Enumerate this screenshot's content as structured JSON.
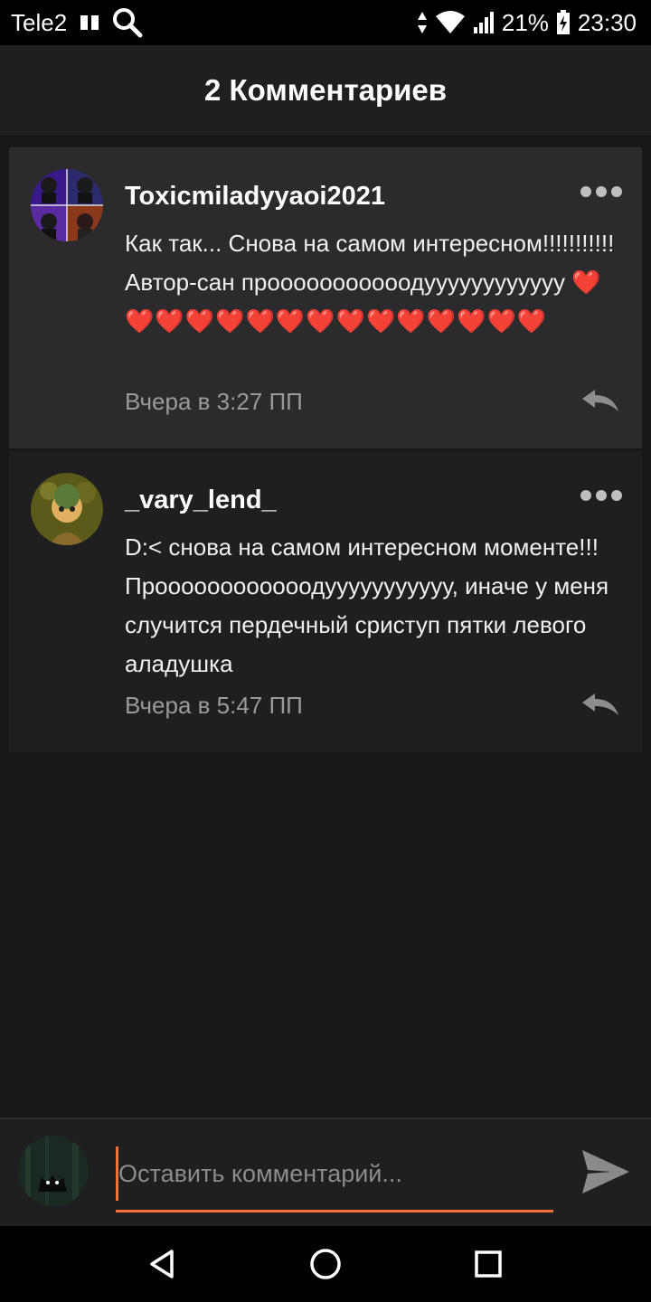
{
  "status_bar": {
    "carrier": "Tele2",
    "battery_percent": "21%",
    "time": "23:30"
  },
  "header": {
    "title": "2 Комментариев"
  },
  "comments": [
    {
      "username": "Toxicmiladyyaoi2021",
      "text": "Как так... Снова на самом интересном!!!!!!!!!!! Автор-сан прооооооооооодуууууууууууу",
      "hearts": "❤️❤️❤️❤️❤️❤️❤️❤️❤️❤️❤️❤️❤️❤️❤️",
      "timestamp": "Вчера в 3:27 ПП"
    },
    {
      "username": "_vary_lend_",
      "text": "D:< снова на самом интересном моменте!!! Проооооооооооодууууууууууу, иначе у меня случится пердечный сриступ пятки левого аладушка",
      "timestamp": "Вчера в 5:47 ПП"
    }
  ],
  "input": {
    "placeholder": "Оставить комментарий..."
  },
  "colors": {
    "accent": "#f5713a",
    "background": "#18171a",
    "highlighted_comment": "#2b2a2d",
    "heart": "#e8141e"
  },
  "icons": {
    "status_bar": [
      "sim-icon",
      "search-icon",
      "data-arrows-icon",
      "wifi-icon",
      "signal-icon",
      "battery-charging-icon"
    ],
    "comment_actions": [
      "more-icon",
      "reply-icon"
    ],
    "input": [
      "send-icon"
    ],
    "nav": [
      "back-icon",
      "home-icon",
      "recents-icon"
    ]
  }
}
